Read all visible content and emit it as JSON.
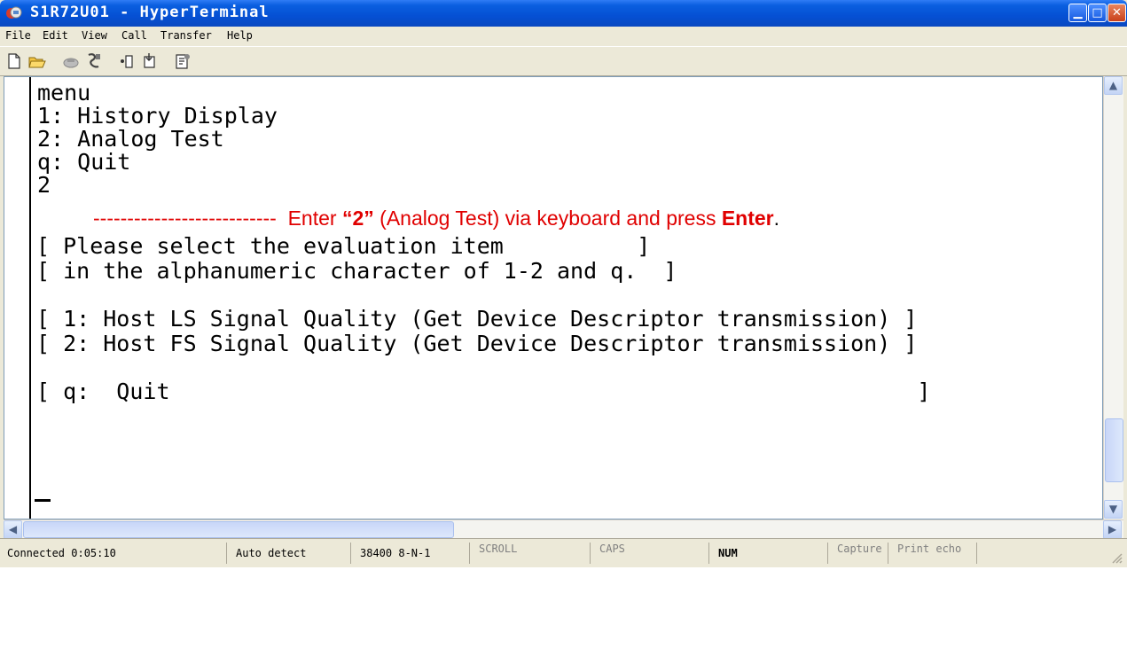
{
  "window": {
    "title": "S1R72U01 - HyperTerminal",
    "minimize_glyph": "▁",
    "maximize_glyph": "□",
    "close_glyph": "✕"
  },
  "menubar": {
    "items": [
      "File",
      "Edit",
      "View",
      "Call",
      "Transfer",
      "Help"
    ]
  },
  "toolbar": {
    "icons": [
      "new-document-icon",
      "open-folder-icon",
      "connect-phone-icon",
      "disconnect-icon",
      "send-icon",
      "receive-icon",
      "properties-icon"
    ]
  },
  "terminal": {
    "lines": [
      "menu",
      "1: History Display",
      "2: Analog Test",
      "q: Quit",
      "2"
    ],
    "annotation": {
      "dashes": "---------------------------",
      "text_a": "  Enter ",
      "quoted": "“2”",
      "text_b": " (Analog Test) via keyboard and press ",
      "enter_word": "Enter",
      "period": "."
    },
    "prompt_lines": [
      "[ Please select the evaluation item          ]",
      "[ in the alphanumeric character of 1-2 and q.  ]"
    ],
    "item_lines": [
      "[ 1: Host LS Signal Quality (Get Device Descriptor transmission) ]",
      "[ 2: Host FS Signal Quality (Get Device Descriptor transmission) ]"
    ],
    "quit_line": "[ q:  Quit                                                        ]"
  },
  "statusbar": {
    "connected": "Connected 0:05:10",
    "detect": "Auto detect",
    "port": "38400 8-N-1",
    "scroll": "SCROLL",
    "caps": "CAPS",
    "num": "NUM",
    "capture": "Capture",
    "print_echo": "Print echo"
  }
}
